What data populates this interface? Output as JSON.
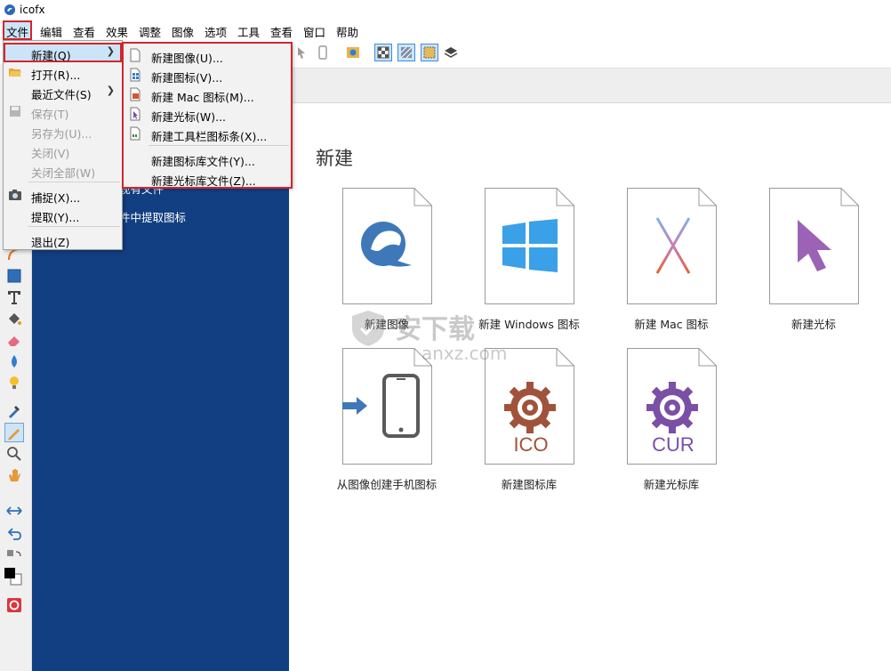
{
  "window": {
    "title": "icofx"
  },
  "menubar": {
    "items": [
      {
        "label": "文件"
      },
      {
        "label": "编辑"
      },
      {
        "label": "查看"
      },
      {
        "label": "效果"
      },
      {
        "label": "调整"
      },
      {
        "label": "图像"
      },
      {
        "label": "选项"
      },
      {
        "label": "工具"
      },
      {
        "label": "查看"
      },
      {
        "label": "窗口"
      },
      {
        "label": "帮助"
      }
    ]
  },
  "file_menu": {
    "items": [
      {
        "label": "新建(Q)",
        "has_submenu": true,
        "highlighted": true,
        "disabled": false
      },
      {
        "label": "打开(R)...",
        "disabled": false
      },
      {
        "label": "最近文件(S)",
        "has_submenu": true,
        "disabled": false
      },
      {
        "label": "保存(T)",
        "disabled": true
      },
      {
        "label": "另存为(U)...",
        "disabled": true
      },
      {
        "label": "关闭(V)",
        "disabled": true
      },
      {
        "label": "关闭全部(W)",
        "disabled": true
      },
      {
        "label": "捕捉(X)...",
        "disabled": false
      },
      {
        "label": "提取(Y)...",
        "disabled": false
      },
      {
        "label": "退出(Z)",
        "disabled": false
      }
    ]
  },
  "new_submenu": {
    "items": [
      {
        "label": "新建图像(U)...",
        "icon": "blank-page-icon"
      },
      {
        "label": "新建图标(V)...",
        "icon": "windows-icon-page-icon"
      },
      {
        "label": "新建 Mac 图标(M)...",
        "icon": "mac-icon-page-icon"
      },
      {
        "label": "新建光标(W)...",
        "icon": "cursor-page-icon"
      },
      {
        "label": "新建工具栏图标条(X)...",
        "icon": "toolbar-strip-page-icon"
      },
      {
        "label": "新建图标库文件(Y)..."
      },
      {
        "label": "新建光标库文件(Z)..."
      }
    ]
  },
  "welcome_panel": {
    "line1": "现有文件",
    "line2": "件中提取图标"
  },
  "main": {
    "section_title": "新建",
    "tiles": [
      {
        "caption": "新建图像",
        "icon": "icofx-logo-icon"
      },
      {
        "caption": "新建 Windows 图标",
        "icon": "windows-logo-icon"
      },
      {
        "caption": "新建 Mac 图标",
        "icon": "mac-x-icon"
      },
      {
        "caption": "新建光标",
        "icon": "cursor-arrow-icon"
      },
      {
        "caption": "从图像创建手机图标",
        "icon": "phone-icon"
      },
      {
        "caption": "新建图标库",
        "icon": "gear-ico-icon",
        "badge": "ICO"
      },
      {
        "caption": "新建光标库",
        "icon": "gear-cur-icon",
        "badge": "CUR"
      }
    ]
  },
  "watermark": {
    "text1": "安下载",
    "text2": "anxz.com"
  },
  "colors": {
    "welcome_bg": "#123f82",
    "menu_highlight": "#cce4f7",
    "annotation_red": "#d2262c",
    "win_blue": "#3aa0e8",
    "cursor_purple": "#9b62b6",
    "ico_brown": "#a0523a",
    "cur_purple": "#7b4fa6"
  }
}
